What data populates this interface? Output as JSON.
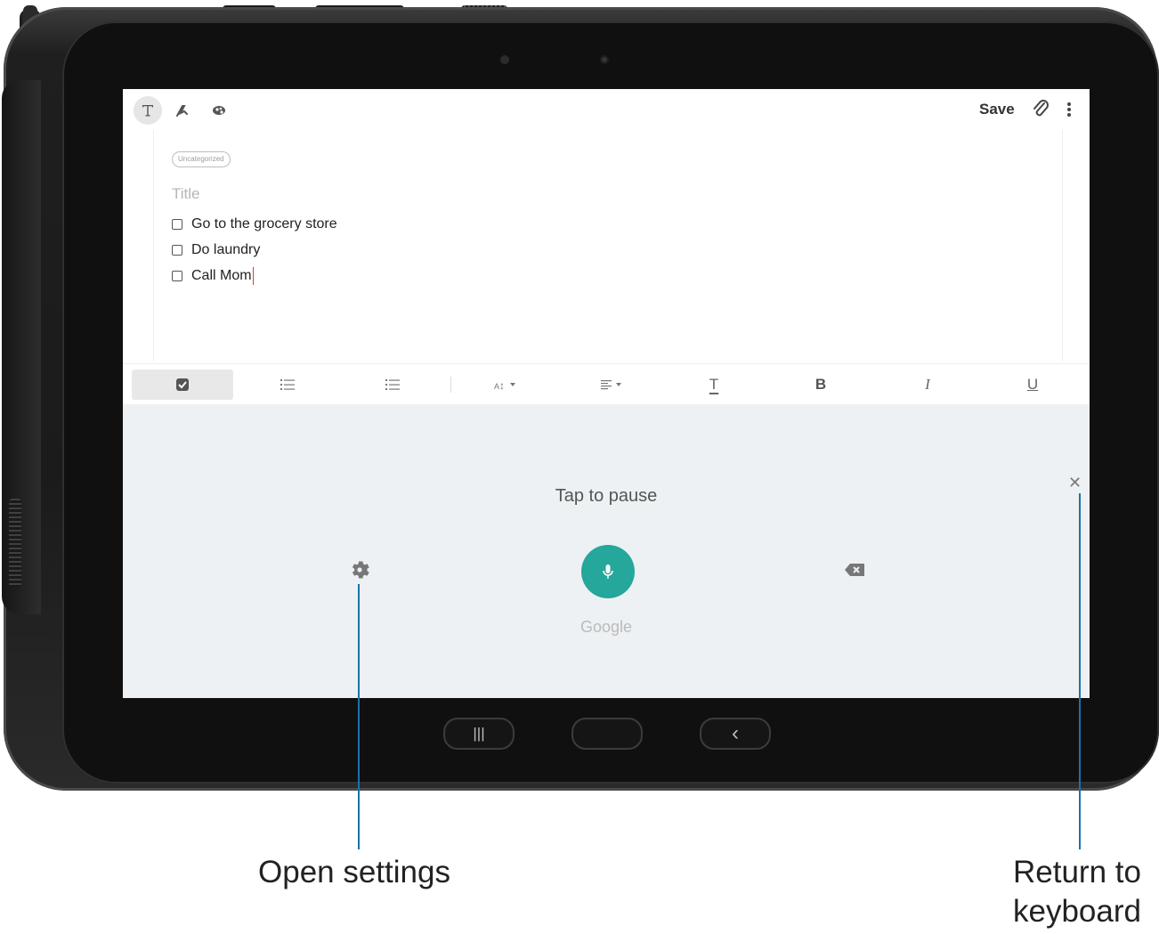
{
  "toolbar": {
    "save_label": "Save",
    "tools": [
      "text-mode-icon",
      "pen-mode-icon",
      "brush-mode-icon"
    ],
    "actions": [
      "attach-icon",
      "more-options-icon"
    ]
  },
  "note": {
    "category": "Uncategorized",
    "title_placeholder": "Title",
    "tasks": [
      {
        "text": "Go to the grocery store",
        "checked": false
      },
      {
        "text": "Do laundry",
        "checked": false
      },
      {
        "text": "Call Mom",
        "checked": false
      }
    ]
  },
  "format_bar": {
    "items": [
      "checkbox-icon",
      "bulleted-list-icon",
      "numbered-list-icon",
      "font-size-icon",
      "align-icon",
      "text-color-icon",
      "bold-icon",
      "italic-icon",
      "underline-icon"
    ],
    "labels": {
      "text_color": "T",
      "bold": "B",
      "italic": "I",
      "underline": "U"
    }
  },
  "voice_input": {
    "status": "Tap to pause",
    "provider": "Google",
    "accent_color": "#25a79b"
  },
  "nav": {
    "recents": "|||",
    "back": "‹"
  },
  "callouts": {
    "settings": "Open settings",
    "keyboard_line1": "Return to",
    "keyboard_line2": "keyboard"
  }
}
